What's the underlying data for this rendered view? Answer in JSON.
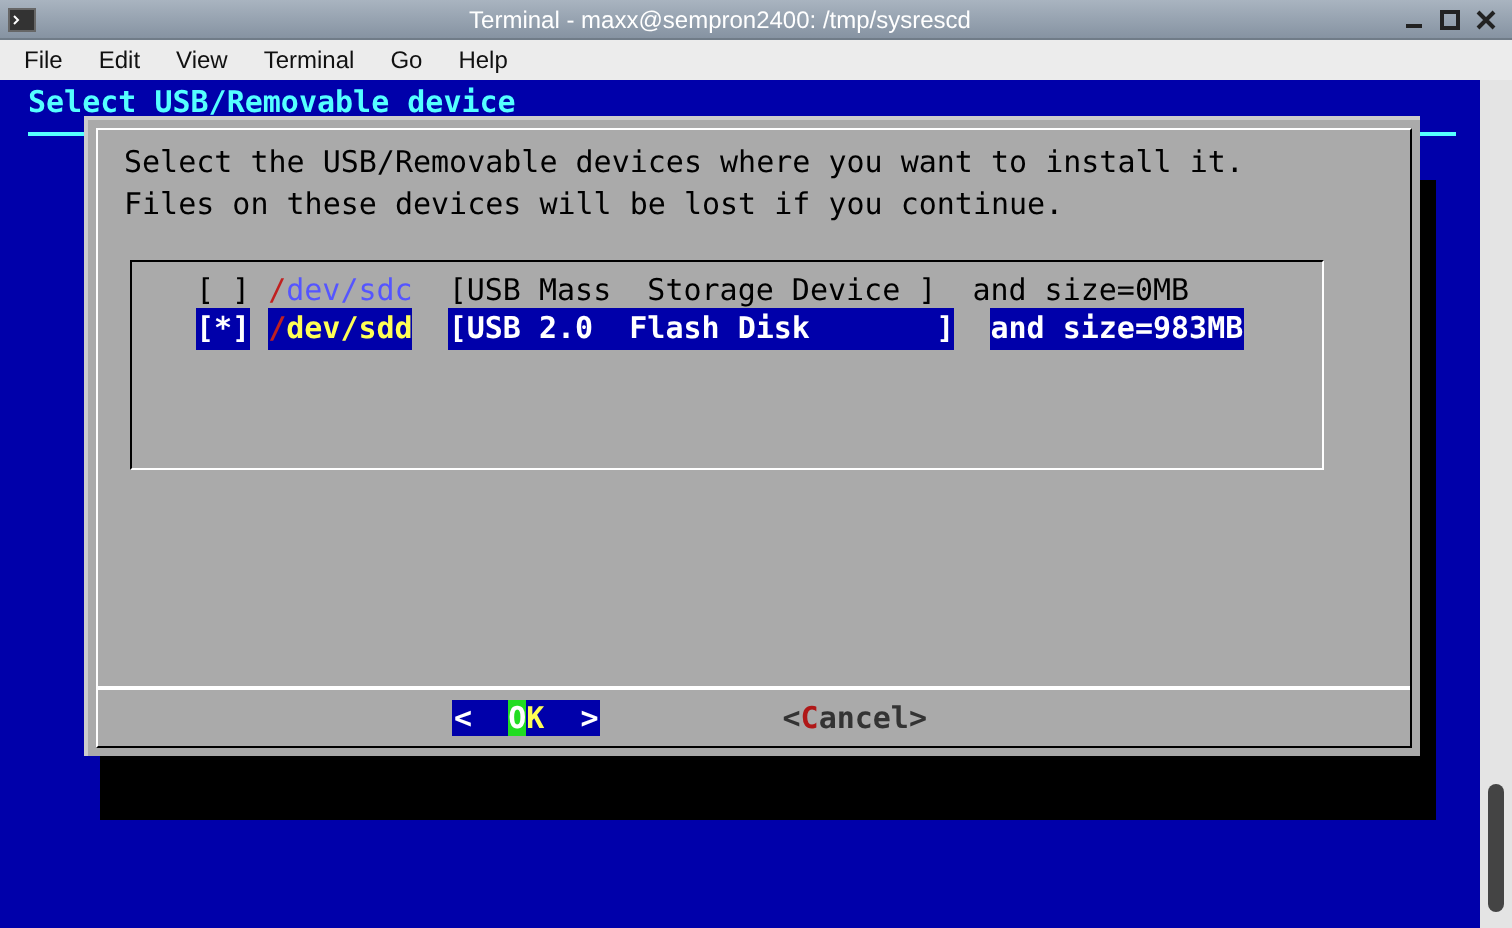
{
  "window": {
    "title": "Terminal - maxx@sempron2400: /tmp/sysrescd"
  },
  "menu": [
    "File",
    "Edit",
    "View",
    "Terminal",
    "Go",
    "Help"
  ],
  "backtitle": "Select USB/Removable device",
  "dialog": {
    "lines": [
      "Select the USB/Removable devices where you want to install it.",
      "Files on these devices will be lost if you continue."
    ],
    "devices": [
      {
        "checkbox": "[ ]",
        "checked": false,
        "selected": false,
        "slash": "/",
        "device": "dev/sdc",
        "description": "[USB Mass  Storage Device ]",
        "size": "and size=0MB"
      },
      {
        "checkbox": "[*]",
        "checked": true,
        "selected": true,
        "slash": "/",
        "device": "dev/sdd",
        "description": "[USB 2.0  Flash Disk       ]",
        "size": "and size=983MB"
      }
    ],
    "buttons": [
      {
        "left": "<  ",
        "hotkey": "O",
        "rest": "K",
        "right": "  >",
        "selected": true
      },
      {
        "left": "<",
        "hotkey": "C",
        "rest": "ancel",
        "right": ">",
        "selected": false
      }
    ]
  }
}
